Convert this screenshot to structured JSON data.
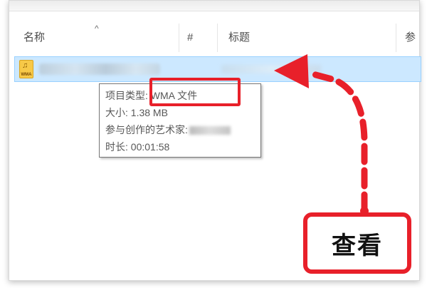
{
  "columns": {
    "name": "名称",
    "number": "#",
    "title": "标题",
    "participating": "参"
  },
  "file": {
    "icon_label": "WMA",
    "icon": "music-note-icon"
  },
  "tooltip": {
    "type_line": "项目类型: WMA 文件",
    "size_line": "大小: 1.38 MB",
    "artist_label": "参与创作的艺术家:",
    "duration_line": "时长: 00:01:58"
  },
  "callout": {
    "label": "查看"
  },
  "colors": {
    "accent_red": "#e8202a",
    "selection_bg": "#cce8ff",
    "selection_border": "#99d1ff"
  }
}
